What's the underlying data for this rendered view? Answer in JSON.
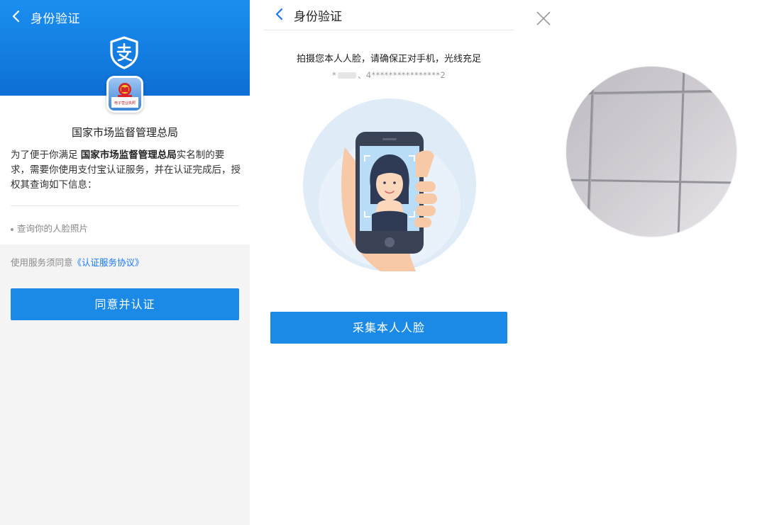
{
  "panel1": {
    "title": "身份验证",
    "back_icon": "chevron-left-icon",
    "logo_icon": "alipay-shield-icon",
    "app_icon": "national-emblem-app-icon",
    "app_icon_caption": "电子营业执照",
    "org_name": "国家市场监督管理总局",
    "desc_prefix": "为了便于你满足 ",
    "desc_org": "国家市场监督管理总局",
    "desc_suffix": "实名制的要求，需要你使用支付宝认证服务，并在认证完成后，授权其查询如下信息：",
    "info_items": [
      "查询你的人脸照片"
    ],
    "agree_prefix": "使用服务须同意",
    "agree_link": "《认证服务协议》",
    "button_label": "同意并认证",
    "colors": {
      "header_blue": "#1b8ff0",
      "button_blue": "#1a8ae6",
      "link_blue": "#1677ff"
    }
  },
  "panel2": {
    "title": "身份验证",
    "back_icon": "chevron-left-icon",
    "instruction": "拍摄您本人人脸，请确保正对手机，光线充足",
    "masked_name": "*",
    "masked_id": "、4****************2",
    "illustration": "face-scan-phone-illustration",
    "button_label": "采集本人人脸"
  },
  "panel3": {
    "close_icon": "close-icon",
    "camera_preview": "camera-preview-circle"
  }
}
